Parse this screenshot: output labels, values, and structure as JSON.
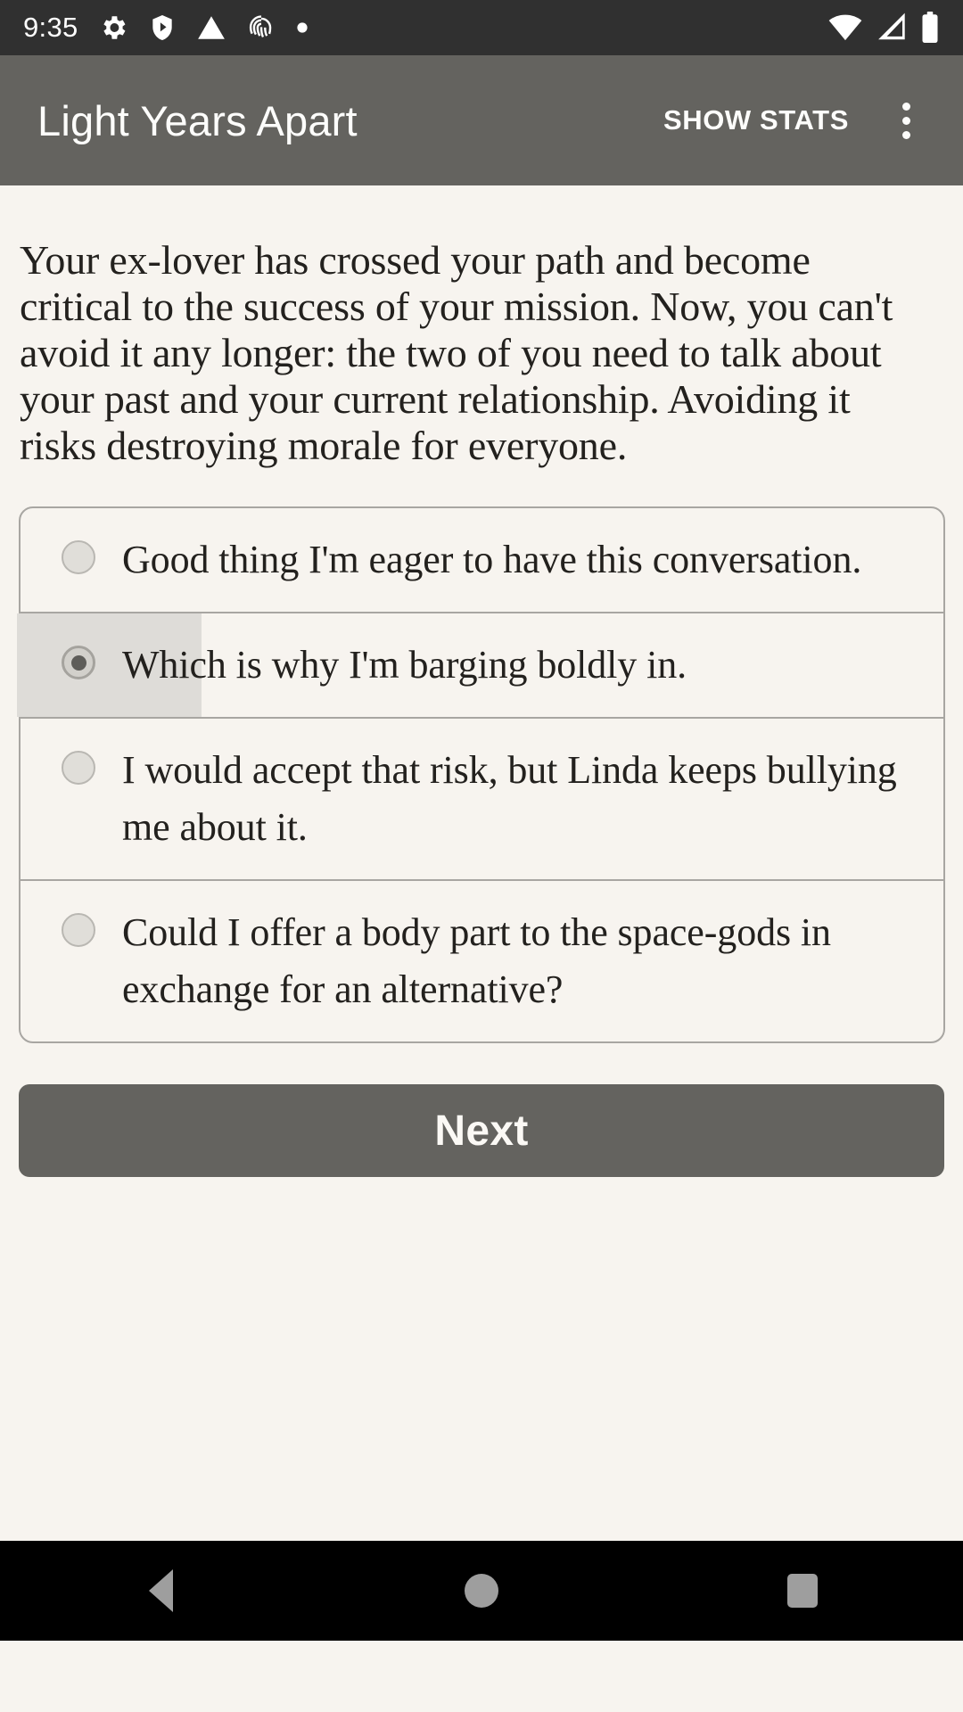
{
  "status_bar": {
    "clock": "9:35",
    "left_icons": [
      "gear-icon",
      "shield-play-icon",
      "warning-icon",
      "fingerprint-icon",
      "dot-icon"
    ],
    "right_icons": [
      "wifi-icon",
      "cell-signal-icon",
      "battery-icon"
    ],
    "background": "#303030"
  },
  "app_bar": {
    "title": "Light Years Apart",
    "action_label": "SHOW STATS",
    "overflow_icon": "more-vert-icon",
    "background": "#64635f",
    "text_color": "#fdfdfb"
  },
  "main": {
    "prompt": "Your ex-lover has crossed your path and become critical to the success of your mission. Now, you can't avoid it any longer: the two of you need to talk about your past and your current relationship. Avoiding it risks destroying morale for everyone.",
    "options": [
      {
        "label": "Good thing I'm eager to have this conversation.",
        "selected": false
      },
      {
        "label": "Which is why I'm barging boldly in.",
        "selected": true
      },
      {
        "label": "I would accept that risk, but Linda keeps bullying me about it.",
        "selected": false
      },
      {
        "label": "Could I offer a body part to the space-gods in exchange for an alternative?",
        "selected": false
      }
    ],
    "next_label": "Next",
    "background": "#f7f4ef",
    "selected_highlight": "#dedcd8"
  },
  "nav_bar": {
    "back_icon": "back-triangle-icon",
    "home_icon": "home-circle-icon",
    "recents_icon": "recents-square-icon",
    "background": "#000000"
  }
}
